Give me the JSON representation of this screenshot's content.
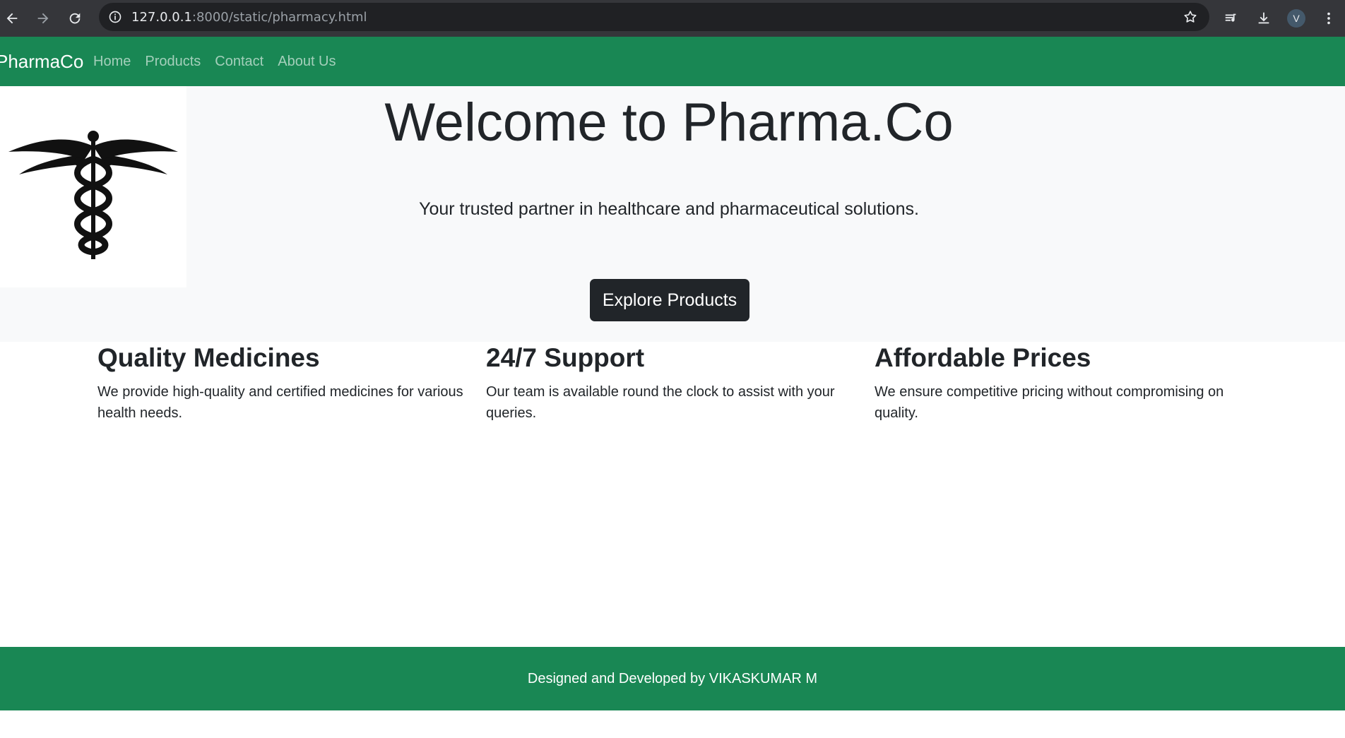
{
  "browser": {
    "url_host": "127.0.0.1",
    "url_rest": ":8000/static/pharmacy.html",
    "profile_initial": "V"
  },
  "navbar": {
    "brand": "PharmaCo",
    "links": [
      "Home",
      "Products",
      "Contact",
      "About Us"
    ]
  },
  "hero": {
    "title": "Welcome to Pharma.Co",
    "subtitle": "Your trusted partner in healthcare and pharmaceutical solutions.",
    "button": "Explore Products"
  },
  "features": [
    {
      "title": "Quality Medicines",
      "text": "We provide high-quality and certified medicines for various health needs."
    },
    {
      "title": "24/7 Support",
      "text": "Our team is available round the clock to assist with your queries."
    },
    {
      "title": "Affordable Prices",
      "text": "We ensure competitive pricing without compromising on quality."
    }
  ],
  "footer": {
    "text": "Designed and Developed by VIKASKUMAR M"
  },
  "colors": {
    "navbar": "#198754",
    "hero_bg": "#f8f9fa",
    "button": "#212529"
  }
}
